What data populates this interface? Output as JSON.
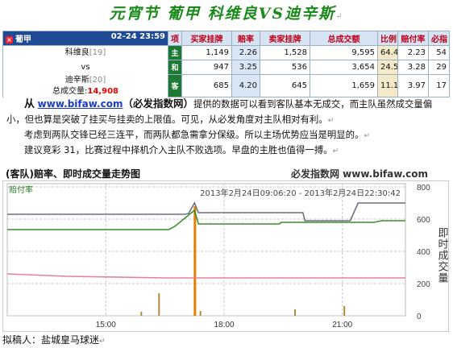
{
  "title": "元宵节  葡甲  科维良VS迪辛斯",
  "para_mark": "↵",
  "table": {
    "league": "葡甲",
    "league_icon": "close-icon",
    "datetime": "02-24 23:59",
    "headers": [
      "项",
      "买家挂牌",
      "赔率",
      "卖家挂牌",
      "总成交额",
      "比例",
      "赔付率",
      "必指"
    ],
    "home_team": "科维良",
    "home_rank": "[19]",
    "vs": "vs",
    "away_team": "迪辛斯",
    "away_rank": "[20]",
    "total_label": "总成交量:",
    "total_value": "14,908",
    "rows": [
      {
        "tag": "主",
        "buy": "1,149",
        "odds": "2.26",
        "sell": "1,528",
        "volume": "9,595",
        "ratio": "64.4",
        "payout": "2.23",
        "index": "54"
      },
      {
        "tag": "和",
        "buy": "947",
        "odds": "3.25",
        "sell": "536",
        "volume": "3,654",
        "ratio": "24.5",
        "payout": "3.28",
        "index": "29"
      },
      {
        "tag": "客",
        "buy": "685",
        "odds": "4.20",
        "sell": "645",
        "volume": "1,659",
        "ratio": "11.1",
        "payout": "3.97",
        "index": "17"
      }
    ],
    "tag_color": "#1c7a32"
  },
  "paragraphs": {
    "p1_lead": "从",
    "p1_link": "www.bifaw.com",
    "p1_brand": "（必发指数网）",
    "p1_text": "提供的数据可以看到客队基本无成交，而主队虽然成交量偏小，但也算是突破了挂买与挂卖的上限值。可见，从必发角度对主队相对有利。",
    "p2": "考虑到两队交锋已经三连平，而两队都急需拿分保级。所以主场优势应当是明显的。",
    "p3": "建议竞彩 31，比赛过程中择机介入主队不败选项。早盘的主胜也值得一搏。"
  },
  "chart_head": {
    "title": "(客队)赔率、即时成交量走势图",
    "site": "必发指数网 www.bifaw.com"
  },
  "chart_data": {
    "type": "line",
    "title": "(客队)赔率、即时成交量走势图",
    "corner_label": "赔付率",
    "time_range_label": "2013年2月24日09:06:20 - 2013年2月24日22:30:42",
    "y_right_label": "即时成交量",
    "x_ticks": [
      "15:00",
      "18:00",
      "21:00"
    ],
    "y_right_ticks": [
      0,
      200,
      400,
      600,
      800
    ],
    "ylim_right": [
      0,
      800
    ],
    "x_range_hours": [
      12.5,
      22.6
    ],
    "grid": true,
    "series": [
      {
        "color": "#6c6f82",
        "values": [
          [
            12.5,
            630
          ],
          [
            17.0,
            630
          ],
          [
            17.1,
            635
          ],
          [
            17.25,
            700
          ],
          [
            17.35,
            640
          ],
          [
            20.0,
            640
          ],
          [
            20.05,
            590
          ],
          [
            21.2,
            590
          ],
          [
            21.4,
            700
          ],
          [
            22.6,
            700
          ]
        ]
      },
      {
        "color": "#3a8f2a",
        "values": [
          [
            12.5,
            535
          ],
          [
            16.6,
            535
          ],
          [
            16.75,
            555
          ],
          [
            17.25,
            655
          ],
          [
            17.35,
            570
          ],
          [
            19.4,
            570
          ],
          [
            19.45,
            580
          ],
          [
            21.8,
            580
          ],
          [
            22.0,
            590
          ],
          [
            22.6,
            590
          ]
        ]
      },
      {
        "color": "#e87e9e",
        "values": [
          [
            12.5,
            260
          ],
          [
            14.0,
            245
          ],
          [
            16.5,
            235
          ],
          [
            22.6,
            235
          ]
        ]
      }
    ],
    "bars": {
      "color": "#b08a3a",
      "values": [
        [
          16.35,
          140
        ],
        [
          17.25,
          680
        ],
        [
          17.4,
          30
        ],
        [
          19.8,
          40
        ],
        [
          21.05,
          60
        ],
        [
          15.9,
          25
        ]
      ]
    },
    "bar_highlight_color": "#e67e00"
  },
  "author": "拟稿人：盐城皇马球迷"
}
